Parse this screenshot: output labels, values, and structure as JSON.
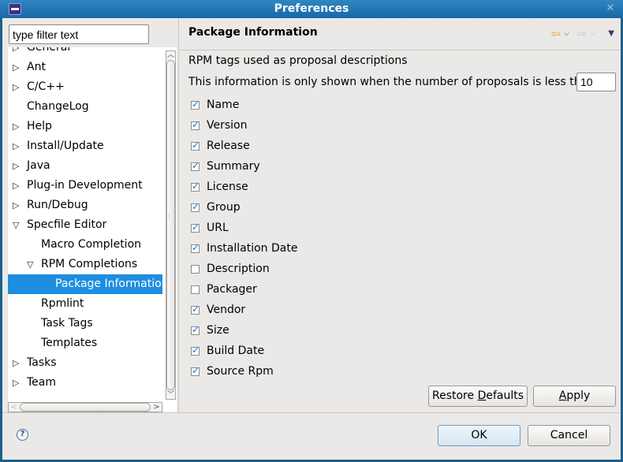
{
  "window": {
    "title": "Preferences",
    "close_icon": "close-icon",
    "app_icon": "eclipse-icon"
  },
  "filter": {
    "value": "type filter text"
  },
  "tree": {
    "items": [
      {
        "label": "General",
        "level": 0,
        "toggle": "collapsed"
      },
      {
        "label": "Ant",
        "level": 0,
        "toggle": "collapsed"
      },
      {
        "label": "C/C++",
        "level": 0,
        "toggle": "collapsed"
      },
      {
        "label": "ChangeLog",
        "level": 0,
        "toggle": "none"
      },
      {
        "label": "Help",
        "level": 0,
        "toggle": "collapsed"
      },
      {
        "label": "Install/Update",
        "level": 0,
        "toggle": "collapsed"
      },
      {
        "label": "Java",
        "level": 0,
        "toggle": "collapsed"
      },
      {
        "label": "Plug-in Development",
        "level": 0,
        "toggle": "collapsed"
      },
      {
        "label": "Run/Debug",
        "level": 0,
        "toggle": "collapsed"
      },
      {
        "label": "Specfile Editor",
        "level": 0,
        "toggle": "expanded"
      },
      {
        "label": "Macro Completion",
        "level": 1,
        "toggle": "none"
      },
      {
        "label": "RPM Completions",
        "level": 1,
        "toggle": "expanded"
      },
      {
        "label": "Package Information",
        "level": 2,
        "toggle": "none",
        "selected": true
      },
      {
        "label": "Rpmlint",
        "level": 1,
        "toggle": "none"
      },
      {
        "label": "Task Tags",
        "level": 1,
        "toggle": "none"
      },
      {
        "label": "Templates",
        "level": 1,
        "toggle": "none"
      },
      {
        "label": "Tasks",
        "level": 0,
        "toggle": "collapsed"
      },
      {
        "label": "Team",
        "level": 0,
        "toggle": "collapsed"
      }
    ]
  },
  "page": {
    "title": "Package Information",
    "nav": {
      "back": "back-arrow-icon",
      "forward": "forward-arrow-icon",
      "menu": "view-menu-icon"
    },
    "description": "RPM tags used as proposal descriptions",
    "threshold_label": "This information is only shown when the number of proposals is less than",
    "threshold_value": "10",
    "tags": [
      {
        "label": "Name",
        "checked": true
      },
      {
        "label": "Version",
        "checked": true
      },
      {
        "label": "Release",
        "checked": true
      },
      {
        "label": "Summary",
        "checked": true
      },
      {
        "label": "License",
        "checked": true
      },
      {
        "label": "Group",
        "checked": true
      },
      {
        "label": "URL",
        "checked": true
      },
      {
        "label": "Installation Date",
        "checked": true
      },
      {
        "label": "Description",
        "checked": false
      },
      {
        "label": "Packager",
        "checked": false
      },
      {
        "label": "Vendor",
        "checked": true
      },
      {
        "label": "Size",
        "checked": true
      },
      {
        "label": "Build Date",
        "checked": true
      },
      {
        "label": "Source Rpm",
        "checked": true
      }
    ],
    "restore_defaults": {
      "pre": "Restore ",
      "mnemonic": "D",
      "post": "efaults"
    },
    "apply": {
      "pre": "",
      "mnemonic": "A",
      "post": "pply"
    }
  },
  "footer": {
    "ok": "OK",
    "cancel": "Cancel",
    "help_icon": "help-icon"
  },
  "colors": {
    "selection": "#1e8ee0",
    "titlebar": "#1868a8",
    "check": "#1a73d6"
  }
}
